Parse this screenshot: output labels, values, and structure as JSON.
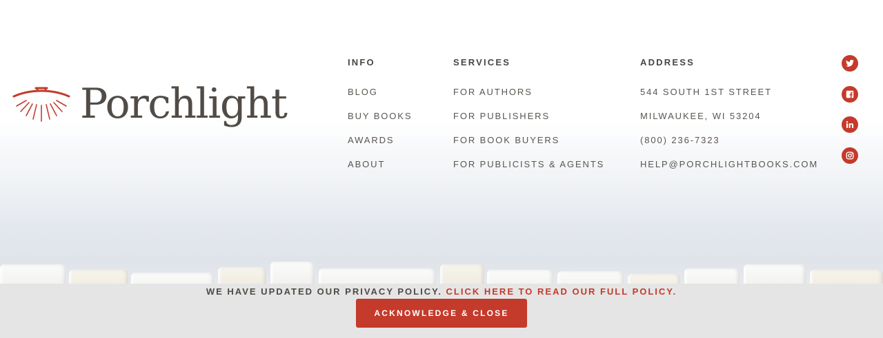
{
  "brand": {
    "name": "Porchlight",
    "accent": "#c43a2b",
    "text_color": "#514c47"
  },
  "footer": {
    "info": {
      "heading": "INFO",
      "links": [
        "BLOG",
        "BUY BOOKS",
        "AWARDS",
        "ABOUT"
      ]
    },
    "services": {
      "heading": "SERVICES",
      "links": [
        "FOR AUTHORS",
        "FOR PUBLISHERS",
        "FOR BOOK BUYERS",
        "FOR PUBLICISTS & AGENTS"
      ]
    },
    "address": {
      "heading": "ADDRESS",
      "lines": [
        "544 SOUTH 1ST STREET",
        "MILWAUKEE, WI 53204",
        "(800) 236-7323",
        "HELP@PORCHLIGHTBOOKS.COM"
      ]
    },
    "social": [
      "twitter-icon",
      "facebook-icon",
      "linkedin-icon",
      "instagram-icon"
    ]
  },
  "privacy_banner": {
    "text": "WE HAVE UPDATED OUR PRIVACY POLICY.",
    "link_text": "CLICK HERE TO READ OUR FULL POLICY.",
    "button_label": "ACKNOWLEDGE & CLOSE"
  }
}
